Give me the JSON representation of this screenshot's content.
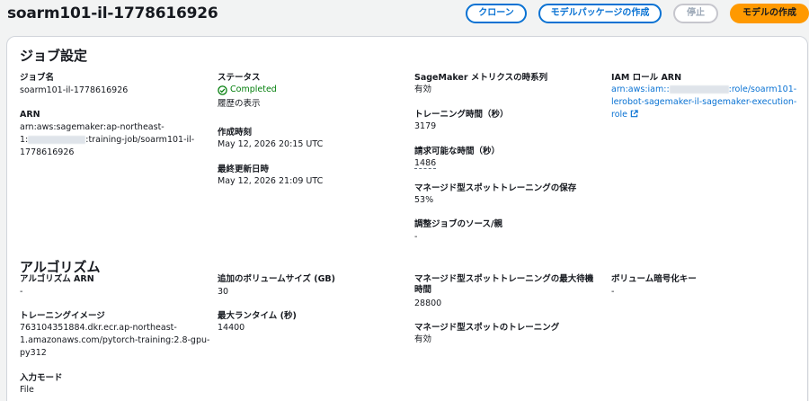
{
  "header": {
    "title": "soarm101-il-1778616926",
    "buttons": {
      "clone": "クローン",
      "create_package": "モデルパッケージの作成",
      "stop": "停止",
      "create_model": "モデルの作成"
    }
  },
  "job_settings": {
    "section_title": "ジョブ設定",
    "job_name_label": "ジョブ名",
    "job_name_value": "soarm101-il-1778616926",
    "arn_label": "ARN",
    "arn_line1": "arn:aws:sagemaker:ap-northeast-",
    "arn_line2_prefix": "1:",
    "arn_line2_suffix": ":training-job/soarm101-il-",
    "arn_line3": "1778616926",
    "status_label": "ステータス",
    "status_value": "Completed",
    "history_link": "履歴の表示",
    "created_label": "作成時刻",
    "created_value": "May 12, 2026 20:15 UTC",
    "updated_label": "最終更新日時",
    "updated_value": "May 12, 2026 21:09 UTC",
    "metrics_label": "SageMaker メトリクスの時系列",
    "metrics_value": "有効",
    "training_time_label": "トレーニング時間（秒）",
    "training_time_value": "3179",
    "billable_label": "請求可能な時間（秒）",
    "billable_value": "1486",
    "spot_savings_label": "マネージド型スポットトレーニングの保存",
    "spot_savings_value": "53%",
    "tuning_label": "調整ジョブのソース/親",
    "tuning_value": "-",
    "iam_label": "IAM ロール ARN",
    "iam_line1_prefix": "arn:aws:iam::",
    "iam_line1_suffix": ":role/soarm101-",
    "iam_line2": "lerobot-sagemaker-il-sagemaker-execution-",
    "iam_line3": "role"
  },
  "algorithm": {
    "section_title": "アルゴリズム",
    "arn_label": "アルゴリズム ARN",
    "arn_value": "-",
    "image_label": "トレーニングイメージ",
    "image_line1": "763104351884.dkr.ecr.ap-northeast-",
    "image_line2": "1.amazonaws.com/pytorch-training:2.8-gpu-",
    "image_line3": "py312",
    "input_mode_label": "入力モード",
    "input_mode_value": "File",
    "volume_label": "追加のボリュームサイズ (GB)",
    "volume_value": "30",
    "runtime_label": "最大ランタイム (秒)",
    "runtime_value": "14400",
    "max_wait_label_1": "マネージド型スポットトレーニングの最大待機",
    "max_wait_label_2": "時間",
    "max_wait_value": "28800",
    "spot_label": "マネージド型スポットのトレーニング",
    "spot_value": "有効",
    "encryption_label": "ボリューム暗号化キー",
    "encryption_value": "-"
  },
  "colors": {
    "link": "#0972d3",
    "primary_button": "#ff9900",
    "success": "#037f0c"
  }
}
